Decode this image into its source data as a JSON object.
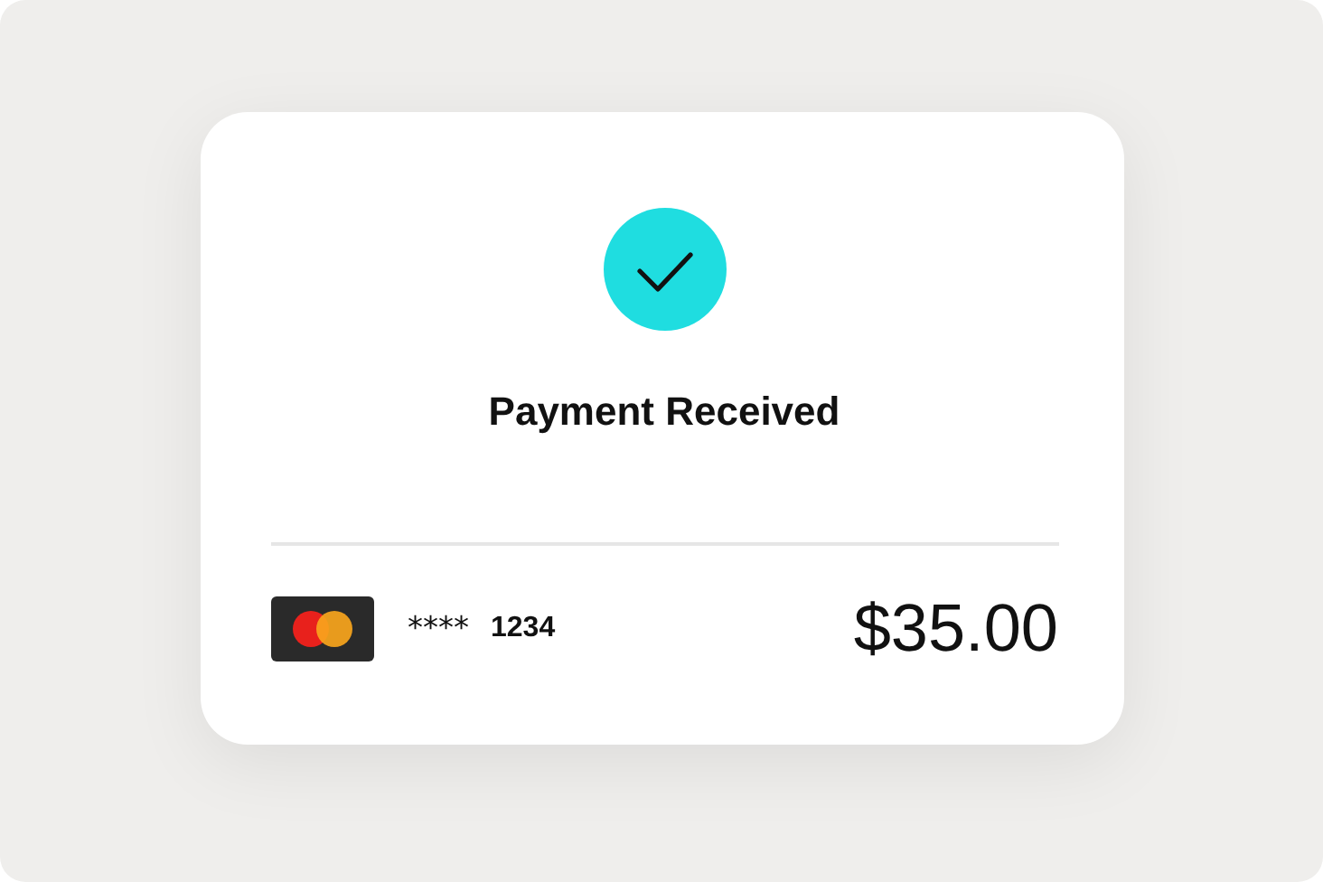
{
  "receipt": {
    "title": "Payment Received",
    "card": {
      "mask": "****",
      "last_digits": "1234"
    },
    "amount": "$35.00"
  }
}
